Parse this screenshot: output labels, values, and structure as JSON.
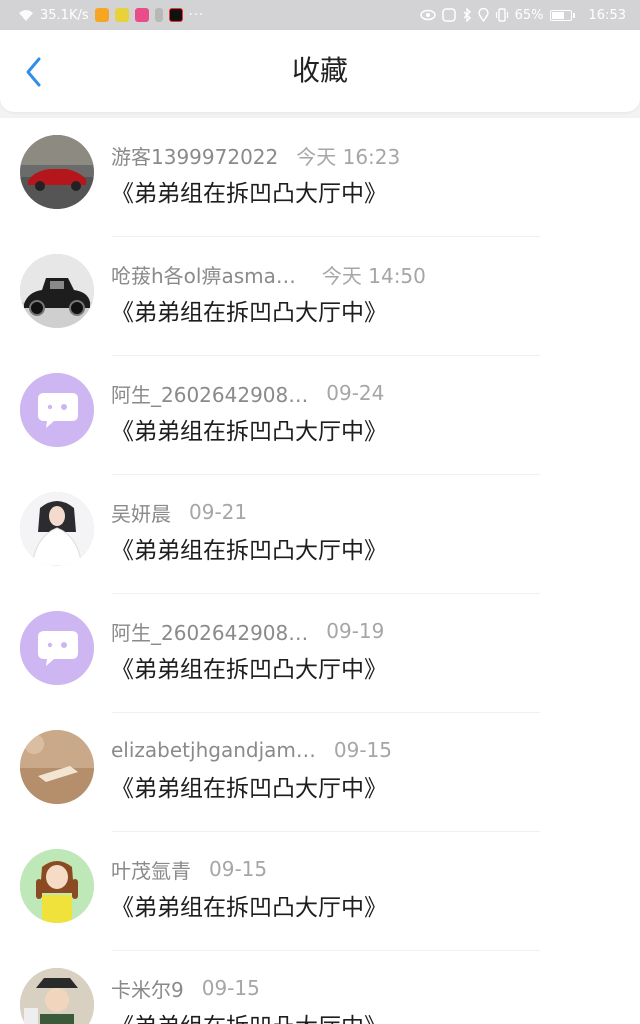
{
  "status_bar": {
    "network_speed": "35.1K/s",
    "more_dots": "···",
    "battery_percent": "65%",
    "time": "16:53"
  },
  "header": {
    "title": "收藏",
    "back_icon": "chevron-left-icon",
    "accent_color": "#2f8fe8"
  },
  "favorites": [
    {
      "user": "游客1399972022",
      "time": "今天 16:23",
      "title": "《弟弟组在拆凹凸大厅中》",
      "avatar": "red-sports-car"
    },
    {
      "user": "呛菝h各ol痹asma…",
      "time": "今天 14:50",
      "title": "《弟弟组在拆凹凸大厅中》",
      "avatar": "vintage-black-car"
    },
    {
      "user": "阿生_2602642908…",
      "time": "09-24",
      "title": "《弟弟组在拆凹凸大厅中》",
      "avatar": "purple-chat-bubble"
    },
    {
      "user": "吴妍晨",
      "time": "09-21",
      "title": "《弟弟组在拆凹凸大厅中》",
      "avatar": "girl-white-dress"
    },
    {
      "user": "阿生_2602642908…",
      "time": "09-19",
      "title": "《弟弟组在拆凹凸大厅中》",
      "avatar": "purple-chat-bubble"
    },
    {
      "user": "elizabetjhgandjam…",
      "time": "09-15",
      "title": "《弟弟组在拆凹凸大厅中》",
      "avatar": "vintage-photo"
    },
    {
      "user": "叶茂氩青",
      "time": "09-15",
      "title": "《弟弟组在拆凹凸大厅中》",
      "avatar": "cartoon-girl"
    },
    {
      "user": "卡米尔9",
      "time": "09-15",
      "title": "《弟弟组在拆凹凸大厅中》",
      "avatar": "anime-character"
    }
  ]
}
